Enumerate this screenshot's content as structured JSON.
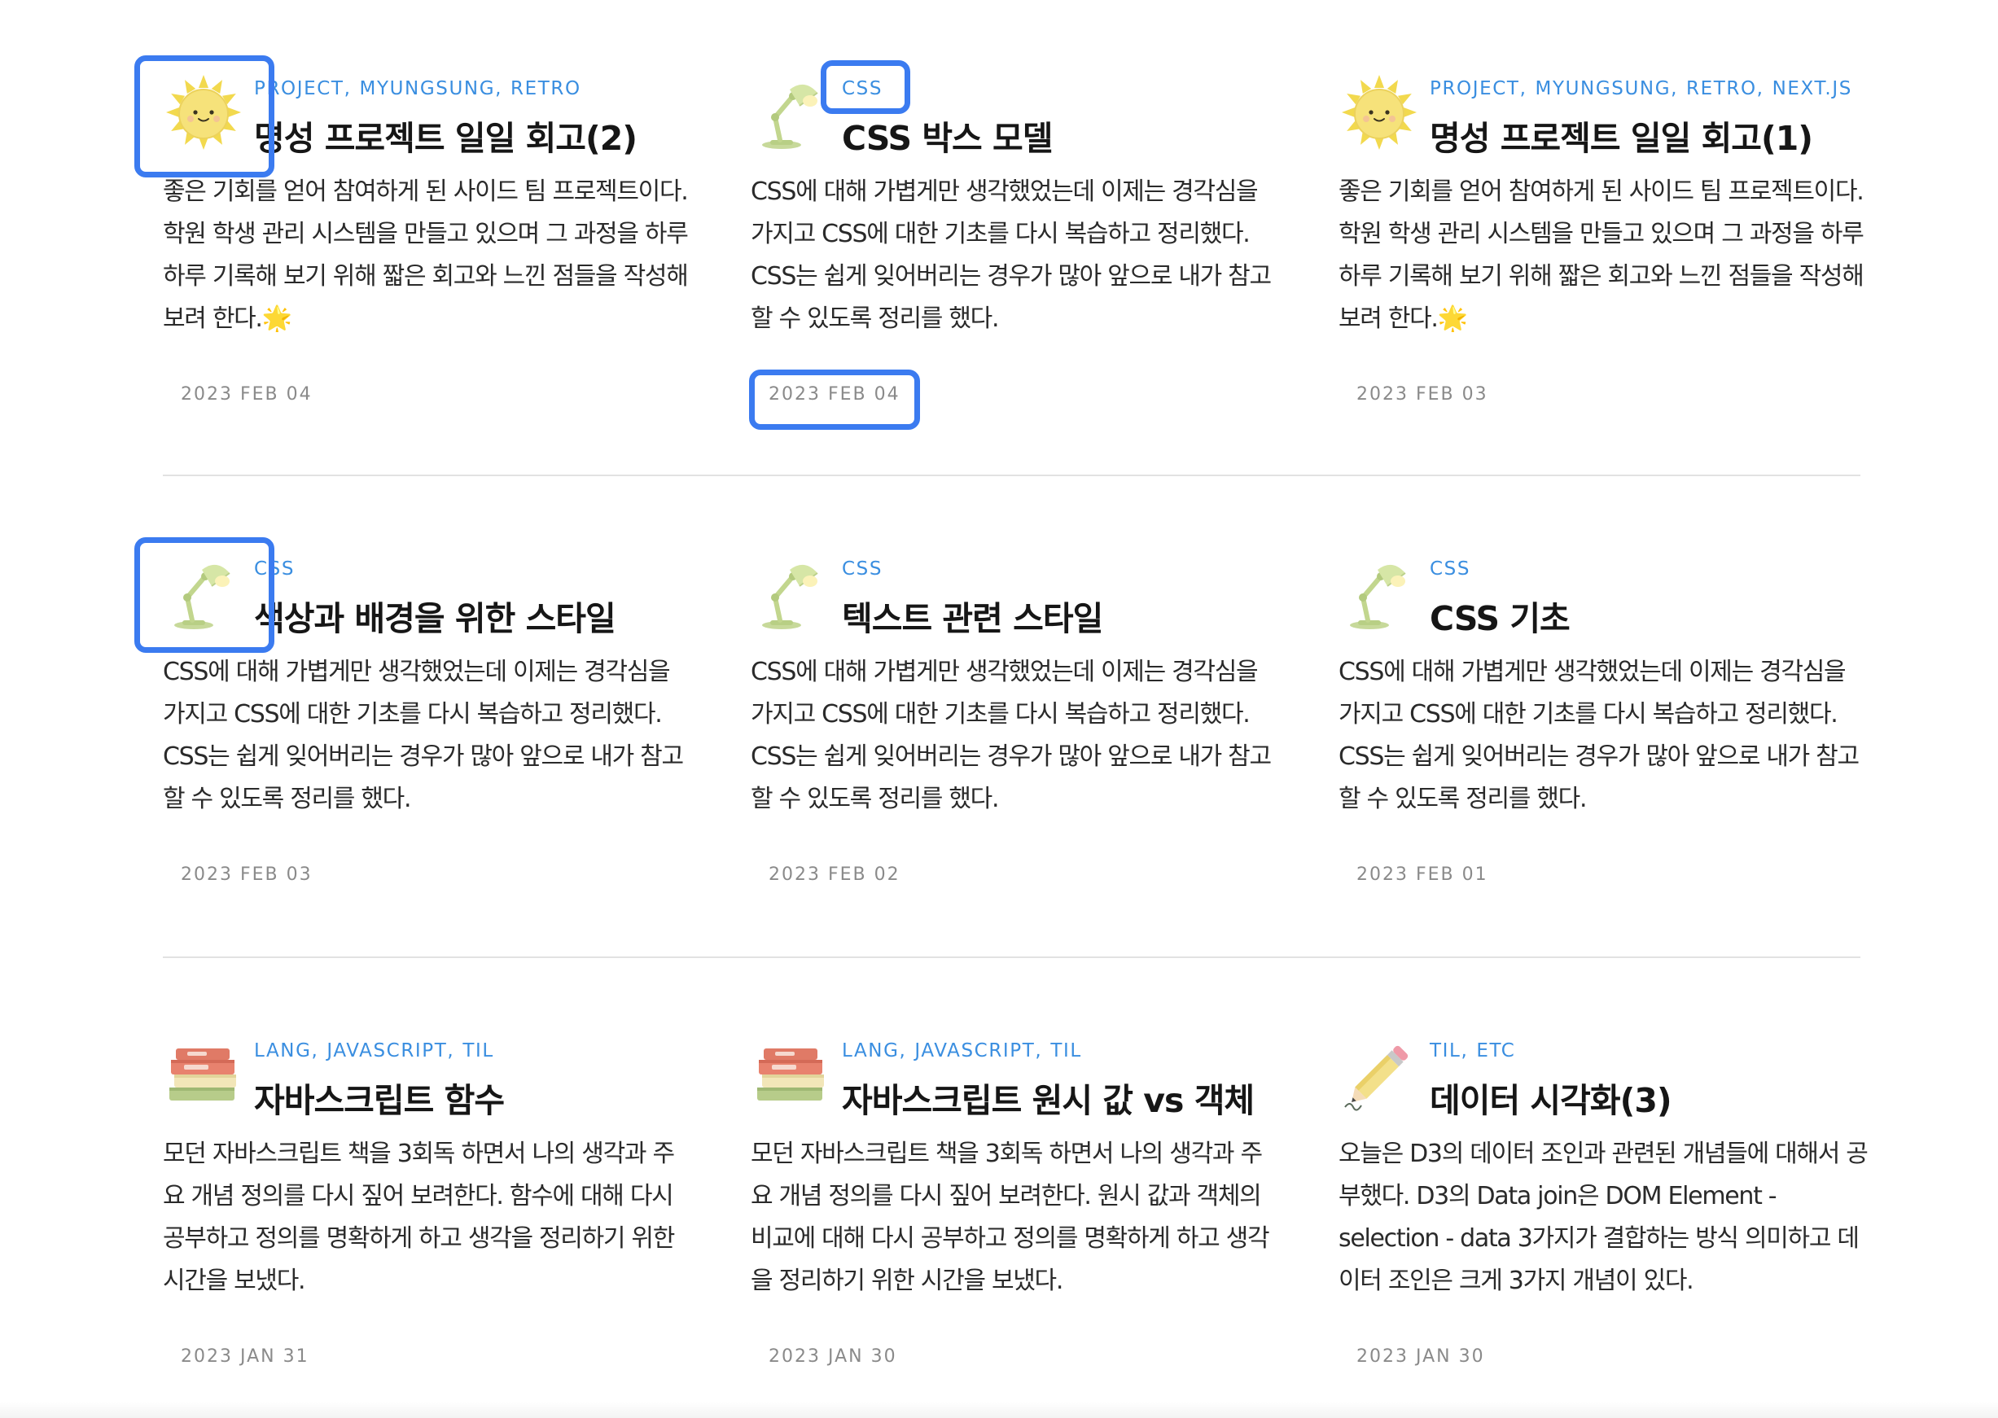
{
  "posts": [
    {
      "icon": "sun-icon",
      "tags": [
        "PROJECT,",
        "MYUNGSUNG,",
        "RETRO"
      ],
      "title": "명성 프로젝트 일일 회고(2)",
      "excerpt": "좋은 기회를 얻어 참여하게 된 사이드 팀 프로젝트이다. 학원 학생 관리 시스템을 만들고 있으며 그 과정을 하루 하루 기록해 보기 위해 짧은 회고와 느낀 점들을 작성해 보려 한다.🌟",
      "date": "2023 FEB 04"
    },
    {
      "icon": "desk-lamp-icon",
      "tags": [
        "CSS"
      ],
      "title": "CSS 박스 모델",
      "excerpt": "CSS에 대해 가볍게만 생각했었는데 이제는 경각심을 가지고 CSS에 대한 기초를 다시 복습하고 정리했다. CSS는 쉽게 잊어버리는 경우가 많아 앞으로 내가 참고할 수 있도록 정리를 했다.",
      "date": "2023 FEB 04"
    },
    {
      "icon": "sun-icon",
      "tags": [
        "PROJECT,",
        "MYUNGSUNG,",
        "RETRO,",
        "NEXT.JS"
      ],
      "title": "명성 프로젝트 일일 회고(1)",
      "excerpt": "좋은 기회를 얻어 참여하게 된 사이드 팀 프로젝트이다. 학원 학생 관리 시스템을 만들고 있으며 그 과정을 하루 하루 기록해 보기 위해 짧은 회고와 느낀 점들을 작성해 보려 한다.🌟",
      "date": "2023 FEB 03"
    },
    {
      "icon": "desk-lamp-icon",
      "tags": [
        "CSS"
      ],
      "title": "색상과 배경을 위한 스타일",
      "excerpt": "CSS에 대해 가볍게만 생각했었는데 이제는 경각심을 가지고 CSS에 대한 기초를 다시 복습하고 정리했다. CSS는 쉽게 잊어버리는 경우가 많아 앞으로 내가 참고할 수 있도록 정리를 했다.",
      "date": "2023 FEB 03"
    },
    {
      "icon": "desk-lamp-icon",
      "tags": [
        "CSS"
      ],
      "title": "텍스트 관련 스타일",
      "excerpt": "CSS에 대해 가볍게만 생각했었는데 이제는 경각심을 가지고 CSS에 대한 기초를 다시 복습하고 정리했다. CSS는 쉽게 잊어버리는 경우가 많아 앞으로 내가 참고할 수 있도록 정리를 했다.",
      "date": "2023 FEB 02"
    },
    {
      "icon": "desk-lamp-icon",
      "tags": [
        "CSS"
      ],
      "title": "CSS 기초",
      "excerpt": "CSS에 대해 가볍게만 생각했었는데 이제는 경각심을 가지고 CSS에 대한 기초를 다시 복습하고 정리했다. CSS는 쉽게 잊어버리는 경우가 많아 앞으로 내가 참고할 수 있도록 정리를 했다.",
      "date": "2023 FEB 01"
    },
    {
      "icon": "books-icon",
      "tags": [
        "LANG,",
        "JAVASCRIPT,",
        "TIL"
      ],
      "title": "자바스크립트 함수",
      "excerpt": "모던 자바스크립트 책을 3회독 하면서 나의 생각과 주요 개념 정의를 다시 짚어 보려한다. 함수에 대해 다시 공부하고 정의를 명확하게 하고 생각을 정리하기 위한 시간을 보냈다.",
      "date": "2023 JAN 31"
    },
    {
      "icon": "books-icon",
      "tags": [
        "LANG,",
        "JAVASCRIPT,",
        "TIL"
      ],
      "title": "자바스크립트 원시 값 vs 객체",
      "excerpt": "모던 자바스크립트 책을 3회독 하면서 나의 생각과 주요 개념 정의를 다시 짚어 보려한다. 원시 값과 객체의 비교에 대해 다시 공부하고 정의를 명확하게 하고 생각을 정리하기 위한 시간을 보냈다.",
      "date": "2023 JAN 30"
    },
    {
      "icon": "pencil-icon",
      "tags": [
        "TIL,",
        "ETC"
      ],
      "title": "데이터 시각화(3)",
      "excerpt": "오늘은 D3의 데이터 조인과 관련된 개념들에 대해서 공부했다. D3의 Data join은 DOM Element - selection - data 3가지가 결합하는 방식 의미하고 데이터 조인은 크게 3가지 개념이 있다.",
      "date": "2023 JAN 30"
    }
  ],
  "colors": {
    "tag": "#3a8ee0",
    "title": "#161616",
    "excerpt": "#2a2a2a",
    "date": "#8a8a8a",
    "divider": "#e2e2e2",
    "highlight": "#3b7bf0"
  }
}
